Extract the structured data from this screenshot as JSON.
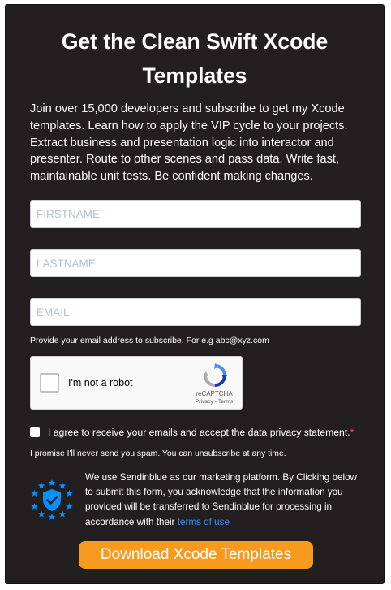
{
  "form": {
    "title": "Get the Clean Swift Xcode Templates",
    "description": "Join over 15,000 developers and subscribe to get my Xcode templates. Learn how to apply the VIP cycle to your projects. Extract business and presentation logic into interactor and presenter. Route to other scenes and pass data. Write fast, maintainable unit tests. Be confident making changes.",
    "firstname": {
      "placeholder": "FIRSTNAME",
      "value": ""
    },
    "lastname": {
      "placeholder": "LASTNAME",
      "value": ""
    },
    "email": {
      "placeholder": "EMAIL",
      "value": ""
    },
    "email_hint": "Provide your email address to subscribe. For e.g abc@xyz.com",
    "captcha": {
      "label": "I'm not a robot",
      "brand": "reCAPTCHA",
      "links": "Privacy - Terms",
      "checked": false
    },
    "consent": {
      "label": "I agree to receive your emails and accept the data privacy statement.",
      "required_mark": "*",
      "checked": false
    },
    "spam_note": "I promise I'll never send you spam. You can unsubscribe at any time.",
    "marketing": {
      "text": "We use Sendinblue as our marketing platform. By Clicking below to submit this form, you acknowledge that the information you provided will be transferred to Sendinblue for processing in accordance with their",
      "link_text": "terms of use",
      "badge_icon": "gdpr-shield-icon"
    },
    "submit_label": "Download Xcode Templates"
  },
  "colors": {
    "card_background": "#231f20",
    "button": "#f89a1d",
    "link": "#3e8be8",
    "required": "#ff4949",
    "badge": "#0092ff",
    "placeholder": "#b3c0d1"
  }
}
